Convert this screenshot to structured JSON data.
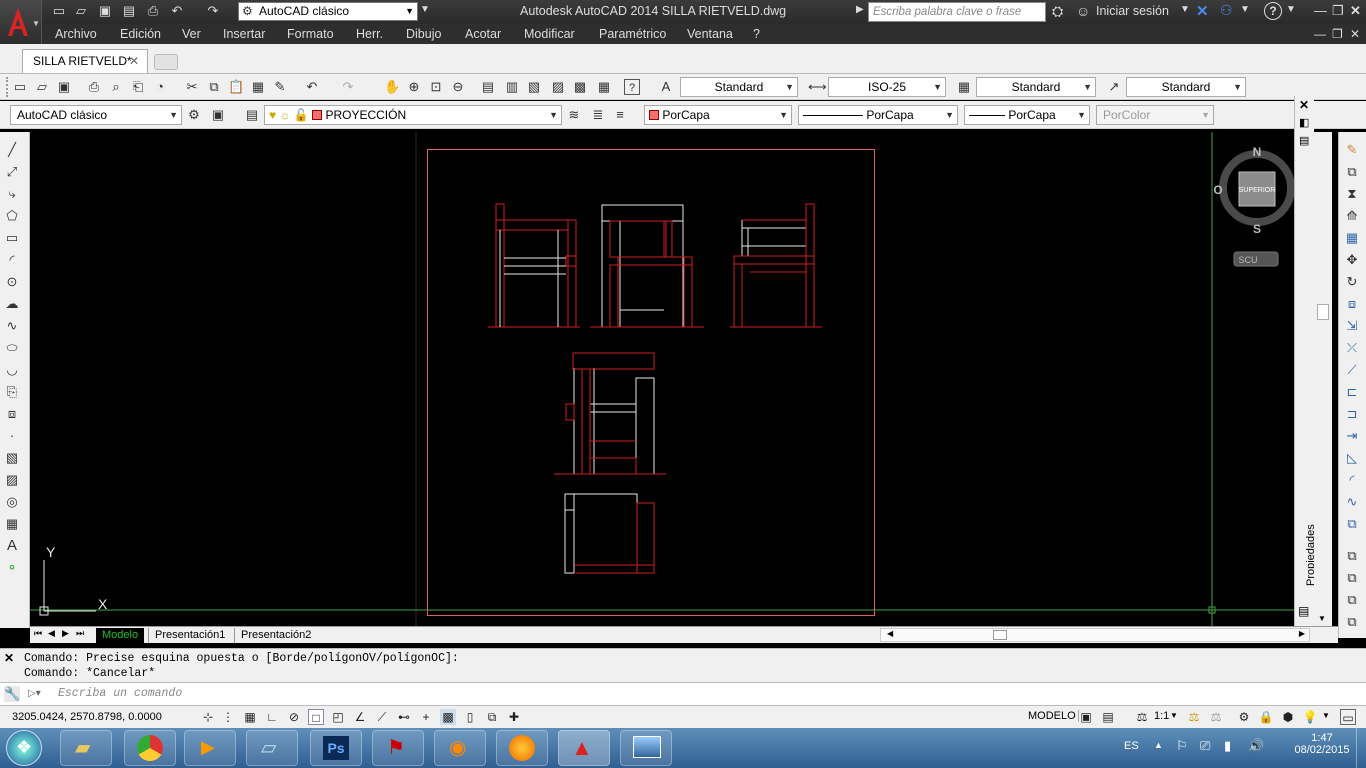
{
  "titlebar": {
    "workspace": "AutoCAD clásico",
    "title": "Autodesk AutoCAD 2014    SILLA RIETVELD.dwg",
    "search_placeholder": "Escriba palabra clave o frase",
    "signin": "Iniciar sesión",
    "help": "?"
  },
  "menubar": [
    "Archivo",
    "Edición",
    "Ver",
    "Insertar",
    "Formato",
    "Herr.",
    "Dibujo",
    "Acotar",
    "Modificar",
    "Paramétrico",
    "Ventana",
    "?"
  ],
  "doc_tab": {
    "label": "SILLA RIETVELD*",
    "close": "✕"
  },
  "styles": {
    "text_style": "Standard",
    "dim_style": "ISO-25",
    "table_style": "Standard",
    "mleader_style": "Standard"
  },
  "layers": {
    "workspace": "AutoCAD clásico",
    "current_layer": "PROYECCIÓN"
  },
  "properties": {
    "color": "PorCapa",
    "linetype": "PorCapa",
    "lineweight": "PorCapa",
    "plotstyle": "PorColor"
  },
  "viewcube": {
    "north": "N",
    "south": "S",
    "west": "O",
    "face": "SUPERIOR",
    "ucs": "SCU"
  },
  "ucs_icon": {
    "x": "X",
    "y": "Y"
  },
  "side_panel": {
    "label": "Propiedades"
  },
  "layout_tabs": [
    "Modelo",
    "Presentación1",
    "Presentación2"
  ],
  "command": {
    "history": [
      "Comando: Precise esquina opuesta o [Borde/polígonOV/polígonOC]:",
      "Comando: *Cancelar*"
    ],
    "placeholder": "Escriba un comando"
  },
  "status": {
    "coords": "3205.0424, 2570.8798, 0.0000",
    "space": "MODELO",
    "scale": "1:1"
  },
  "taskbar": {
    "lang": "ES",
    "time": "1:47",
    "date": "08/02/2015"
  },
  "colors": {
    "canvas": "#000000",
    "drawing": "#d02020",
    "drawing_light": "#e8e8e8",
    "grid_axis": "#3fa63f",
    "active_tab": "#22c022"
  }
}
